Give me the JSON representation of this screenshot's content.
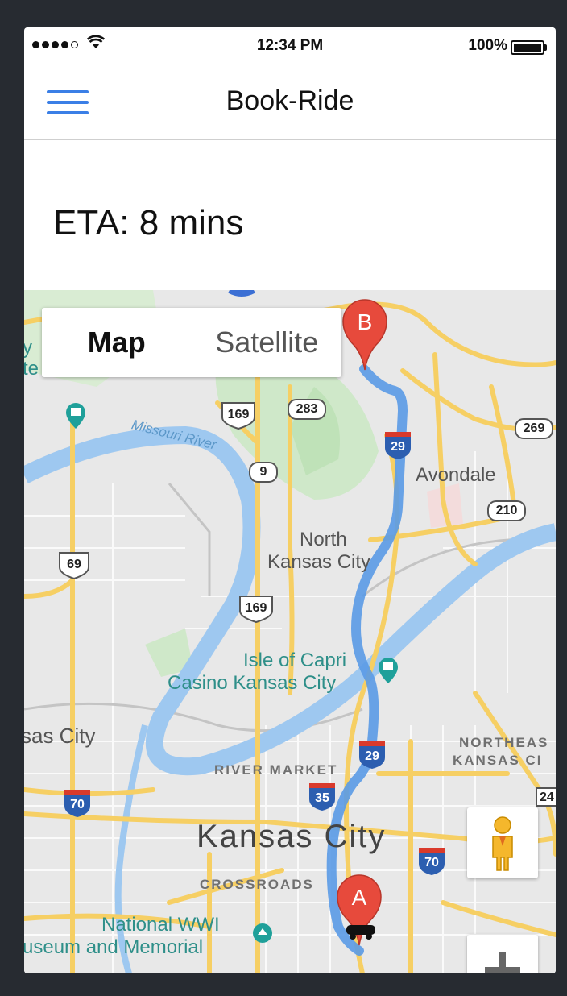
{
  "status_bar": {
    "time": "12:34 PM",
    "battery": "100%"
  },
  "navbar": {
    "title": "Book-Ride"
  },
  "eta": {
    "text": "ETA: 8 mins"
  },
  "map": {
    "type_control": {
      "map_label": "Map",
      "satellite_label": "Satellite",
      "selected": "Map"
    },
    "markers": {
      "start": "A",
      "end": "B"
    },
    "labels": {
      "avondale": "Avondale",
      "north_kc_line1": "North",
      "north_kc_line2": "Kansas City",
      "isle_line1": "Isle of Capri",
      "isle_line2": "Casino Kansas City",
      "kansas_city": "Kansas City",
      "river_market": "RIVER MARKET",
      "crossroads": "CROSSROADS",
      "northeast_line1": "NORTHEAS",
      "northeast_line2": "KANSAS CI",
      "west_kc": "sas City",
      "wwi_line1": "National WWI",
      "wwi_line2": "useum and Memorial",
      "missouri_river": "Missouri River",
      "edge_y": "y",
      "edge_te": "te"
    },
    "shields": {
      "us169_top": "169",
      "rt283": "283",
      "rt269": "269",
      "i29_top": "29",
      "rt9": "9",
      "rt210": "210",
      "us69": "69",
      "us169_mid": "169",
      "i29_bottom": "29",
      "i35": "35",
      "i70_left": "70",
      "i70_right": "70",
      "edge_24": "24"
    },
    "route_color": "#5a9ae6",
    "controls": [
      "pegman-icon",
      "zoom-in-icon"
    ]
  }
}
